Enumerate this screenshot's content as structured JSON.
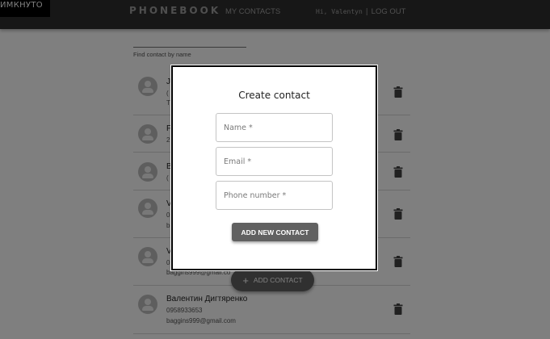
{
  "lang_badge": "ИМКНУТО",
  "header": {
    "brand": "PHONEBOOK",
    "nav_link": "MY CONTACTS",
    "greeting": "Hi, Valentyn",
    "separator": "|",
    "logout": "LOG OUT"
  },
  "filter": {
    "label": "Find contact by name"
  },
  "contacts": [
    {
      "name": "J",
      "phone": "(",
      "email": "T"
    },
    {
      "name": "F",
      "phone": "2",
      "email": ""
    },
    {
      "name": "B",
      "phone": "(",
      "email": ""
    },
    {
      "name": "V",
      "phone": "0",
      "email": "b"
    },
    {
      "name": "V",
      "phone": "0",
      "email": "baggins999@gmail.co"
    },
    {
      "name": "Валентин Дигтяренко",
      "phone": "0958933653",
      "email": "baggins999@gmail.com"
    }
  ],
  "fab": {
    "icon": "plus-icon",
    "label": "ADD CONTACT"
  },
  "modal": {
    "title": "Create contact",
    "name_placeholder": "Name *",
    "email_placeholder": "Email *",
    "phone_placeholder": "Phone number *",
    "submit_label": "ADD NEW CONTACT"
  },
  "colors": {
    "appbar": "#2f2f2f",
    "button": "#616161",
    "avatar": "#bdbdbd",
    "overlay": "rgba(0,0,0,0.5)"
  }
}
